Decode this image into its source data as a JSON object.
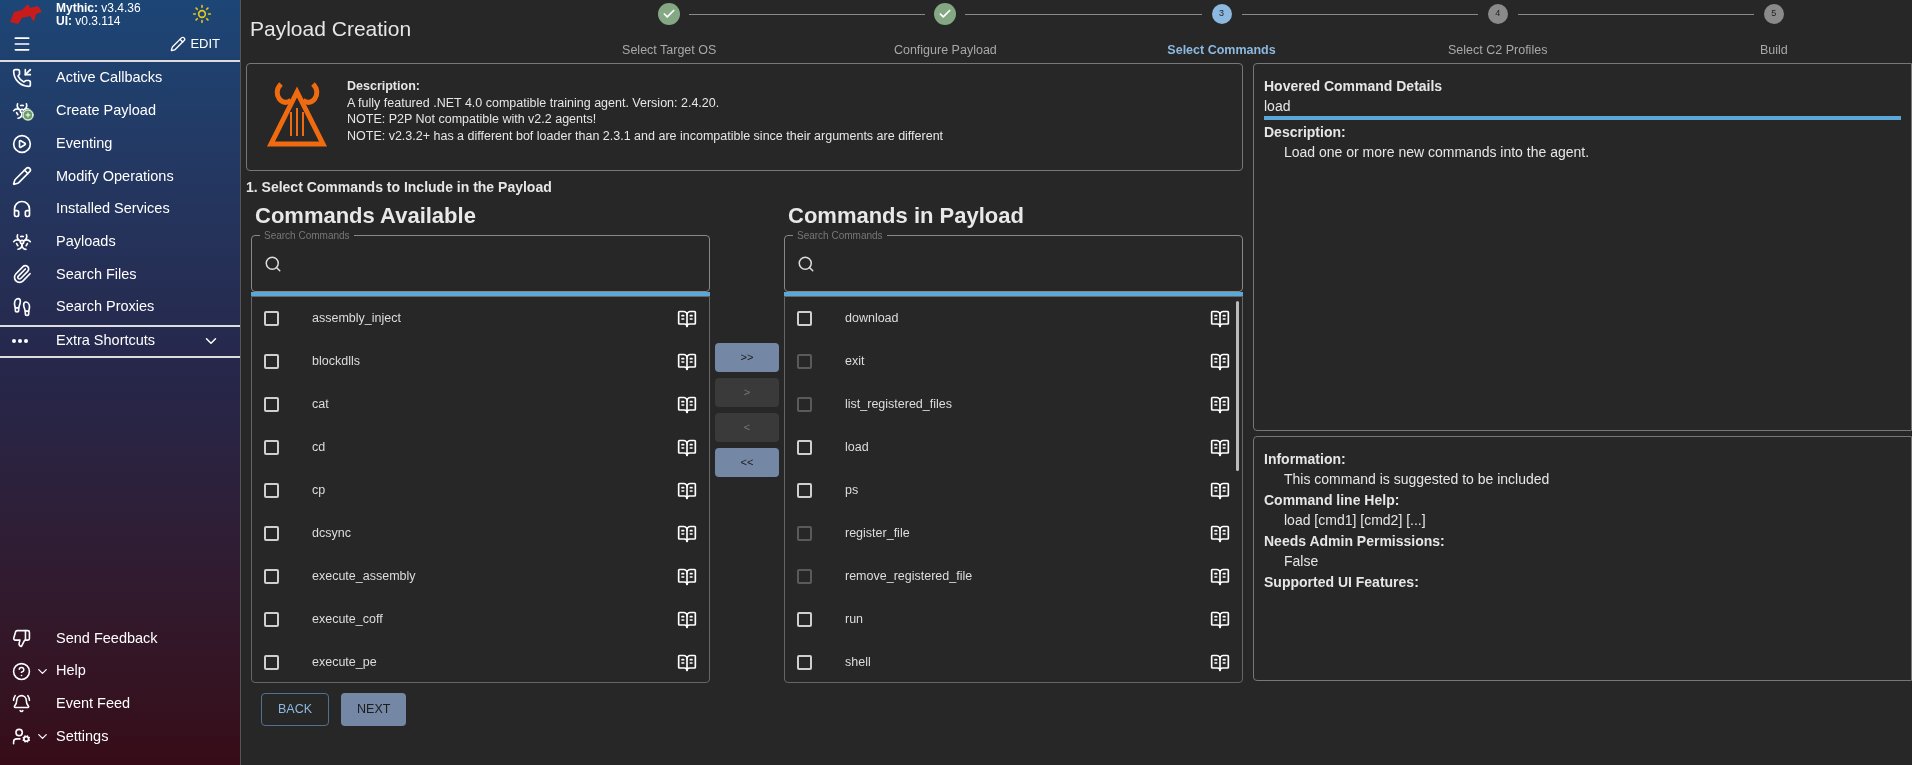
{
  "sidebar": {
    "versions": [
      {
        "label": "Mythic:",
        "value": "v3.4.36"
      },
      {
        "label": "UI:",
        "value": "v0.3.114"
      }
    ],
    "edit_button": "EDIT",
    "items": [
      {
        "label": "Active Callbacks"
      },
      {
        "label": "Create Payload"
      },
      {
        "label": "Eventing"
      },
      {
        "label": "Modify Operations"
      },
      {
        "label": "Installed Services"
      },
      {
        "label": "Payloads"
      },
      {
        "label": "Search Files"
      },
      {
        "label": "Search Proxies"
      }
    ],
    "extra": {
      "label": "Extra Shortcuts",
      "expanded": false
    },
    "bottom_items": [
      {
        "label": "Send Feedback",
        "dropdown": false
      },
      {
        "label": "Help",
        "dropdown": true
      },
      {
        "label": "Event Feed",
        "dropdown": false
      },
      {
        "label": "Settings",
        "dropdown": true
      }
    ]
  },
  "page_title": "Payload Creation",
  "steps": [
    {
      "label": "Select Target OS",
      "completed": true,
      "active": false
    },
    {
      "label": "Configure Payload",
      "completed": true,
      "active": false
    },
    {
      "label": "Select Commands",
      "number": "3",
      "completed": false,
      "active": true
    },
    {
      "label": "Select C2 Profiles",
      "number": "4",
      "completed": false,
      "active": false
    },
    {
      "label": "Build",
      "number": "5",
      "completed": false,
      "active": false
    }
  ],
  "agent": {
    "heading": "Description:",
    "lines": [
      "A fully featured .NET 4.0 compatible training agent. Version: 2.4.20.",
      "NOTE: P2P Not compatible with v2.2 agents!",
      "NOTE: v2.3.2+ has a different bof loader than 2.3.1 and are incompatible since their arguments are different"
    ]
  },
  "section_title": "1. Select Commands to Include in the Payload",
  "available": {
    "title": "Commands Available",
    "search_placeholder": "Search Commands",
    "items": [
      {
        "name": "assembly_inject",
        "checked": false,
        "disabled": false
      },
      {
        "name": "blockdlls",
        "checked": false,
        "disabled": false
      },
      {
        "name": "cat",
        "checked": false,
        "disabled": false
      },
      {
        "name": "cd",
        "checked": false,
        "disabled": false
      },
      {
        "name": "cp",
        "checked": false,
        "disabled": false
      },
      {
        "name": "dcsync",
        "checked": false,
        "disabled": false
      },
      {
        "name": "execute_assembly",
        "checked": false,
        "disabled": false
      },
      {
        "name": "execute_coff",
        "checked": false,
        "disabled": false
      },
      {
        "name": "execute_pe",
        "checked": false,
        "disabled": false
      }
    ]
  },
  "transfer_buttons": [
    {
      "label": ">>",
      "disabled": false
    },
    {
      "label": ">",
      "disabled": true
    },
    {
      "label": "<",
      "disabled": true
    },
    {
      "label": "<<",
      "disabled": false
    }
  ],
  "payload": {
    "title": "Commands in Payload",
    "search_placeholder": "Search Commands",
    "items": [
      {
        "name": "download",
        "checked": false,
        "disabled": false
      },
      {
        "name": "exit",
        "checked": false,
        "disabled": true
      },
      {
        "name": "list_registered_files",
        "checked": false,
        "disabled": true
      },
      {
        "name": "load",
        "checked": false,
        "disabled": false
      },
      {
        "name": "ps",
        "checked": false,
        "disabled": false
      },
      {
        "name": "register_file",
        "checked": false,
        "disabled": true
      },
      {
        "name": "remove_registered_file",
        "checked": false,
        "disabled": true
      },
      {
        "name": "run",
        "checked": false,
        "disabled": false
      },
      {
        "name": "shell",
        "checked": false,
        "disabled": false
      }
    ]
  },
  "nav_buttons": [
    {
      "label": "BACK",
      "kind": "outline"
    },
    {
      "label": "NEXT",
      "kind": "filled"
    }
  ],
  "hovered": {
    "title": "Hovered Command Details",
    "command": "load",
    "sections": [
      {
        "label": "Description:",
        "value": "Load one or more new commands into the agent."
      }
    ]
  },
  "info": {
    "sections": [
      {
        "label": "Information:",
        "value": "This command is suggested to be included"
      },
      {
        "label": "Command line Help:",
        "value": "load [cmd1] [cmd2] [...]"
      },
      {
        "label": "Needs Admin Permissions:",
        "value": "False"
      },
      {
        "label": "Supported UI Features:"
      }
    ]
  }
}
